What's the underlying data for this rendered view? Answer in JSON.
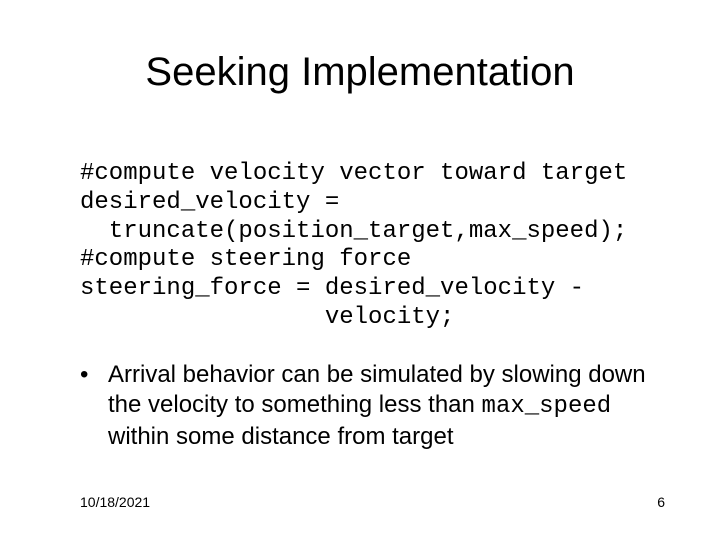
{
  "title": "Seeking Implementation",
  "code": {
    "l1": "#compute velocity vector toward target",
    "l2": "desired_velocity =",
    "l3": "  truncate(position_target,max_speed);",
    "l4": "#compute steering force",
    "l5": "steering_force = desired_velocity -",
    "l6": "                 velocity;"
  },
  "bullet": {
    "marker": "•",
    "pre": "Arrival behavior can be simulated by slowing down the velocity to something less than ",
    "code": "max_speed",
    "post": " within some distance from target"
  },
  "footer": {
    "date": "10/18/2021",
    "page": "6"
  }
}
